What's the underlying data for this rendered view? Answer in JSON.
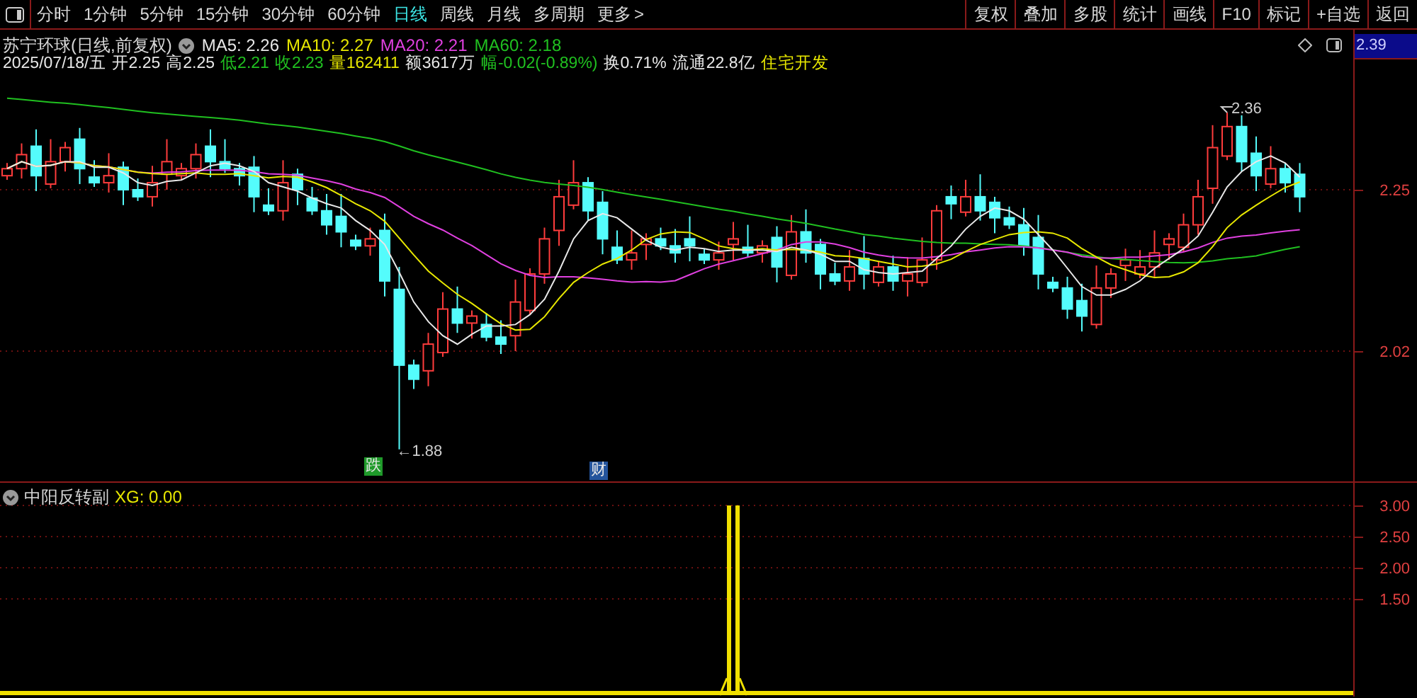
{
  "toolbar": {
    "periods": [
      {
        "label": "分时",
        "selected": false
      },
      {
        "label": "1分钟",
        "selected": false
      },
      {
        "label": "5分钟",
        "selected": false
      },
      {
        "label": "15分钟",
        "selected": false
      },
      {
        "label": "30分钟",
        "selected": false
      },
      {
        "label": "60分钟",
        "selected": false
      },
      {
        "label": "日线",
        "selected": true
      },
      {
        "label": "周线",
        "selected": false
      },
      {
        "label": "月线",
        "selected": false
      },
      {
        "label": "多周期",
        "selected": false
      },
      {
        "label": "更多",
        "selected": false
      }
    ],
    "more_arrow": ">",
    "actions": [
      "复权",
      "叠加",
      "多股",
      "统计",
      "画线",
      "F10",
      "标记",
      "+自选",
      "返回"
    ]
  },
  "header": {
    "title": "苏宁环球(日线,前复权)",
    "moving_averages": [
      {
        "label": "MA5: 2.26",
        "color": "#e8e8e8"
      },
      {
        "label": "MA10: 2.27",
        "color": "#e8e800"
      },
      {
        "label": "MA20: 2.21",
        "color": "#e040e0"
      },
      {
        "label": "MA60: 2.18",
        "color": "#20c020"
      }
    ],
    "quote": [
      {
        "text": "2025/07/18/五",
        "color": "#e8e8e8"
      },
      {
        "text": "开2.25",
        "color": "#e8e8e8"
      },
      {
        "text": "高2.25",
        "color": "#e8e8e8"
      },
      {
        "text": "低2.21",
        "color": "#20c020"
      },
      {
        "text": "收2.23",
        "color": "#20c020"
      },
      {
        "text": "量162411",
        "color": "#e8e800"
      },
      {
        "text": "额3617万",
        "color": "#e8e8e8"
      },
      {
        "text": "幅-0.02(-0.89%)",
        "color": "#20c020"
      },
      {
        "text": "换0.71%",
        "color": "#e8e8e8"
      },
      {
        "text": "流通22.8亿",
        "color": "#e8e8e8"
      },
      {
        "text": "住宅开发",
        "color": "#e8e800"
      }
    ]
  },
  "price_chart": {
    "axis_labels": [
      "2.39",
      "2.25",
      "2.02"
    ],
    "high_label": "2.36",
    "low_label": "←1.88",
    "markers": [
      {
        "text": "跌",
        "color": "#1f9a2a"
      },
      {
        "text": "财",
        "color": "#24549c"
      }
    ]
  },
  "indicator": {
    "title": "中阳反转副",
    "value": "XG: 0.00",
    "axis_labels": [
      "3.00",
      "2.50",
      "2.00",
      "1.50"
    ]
  }
}
